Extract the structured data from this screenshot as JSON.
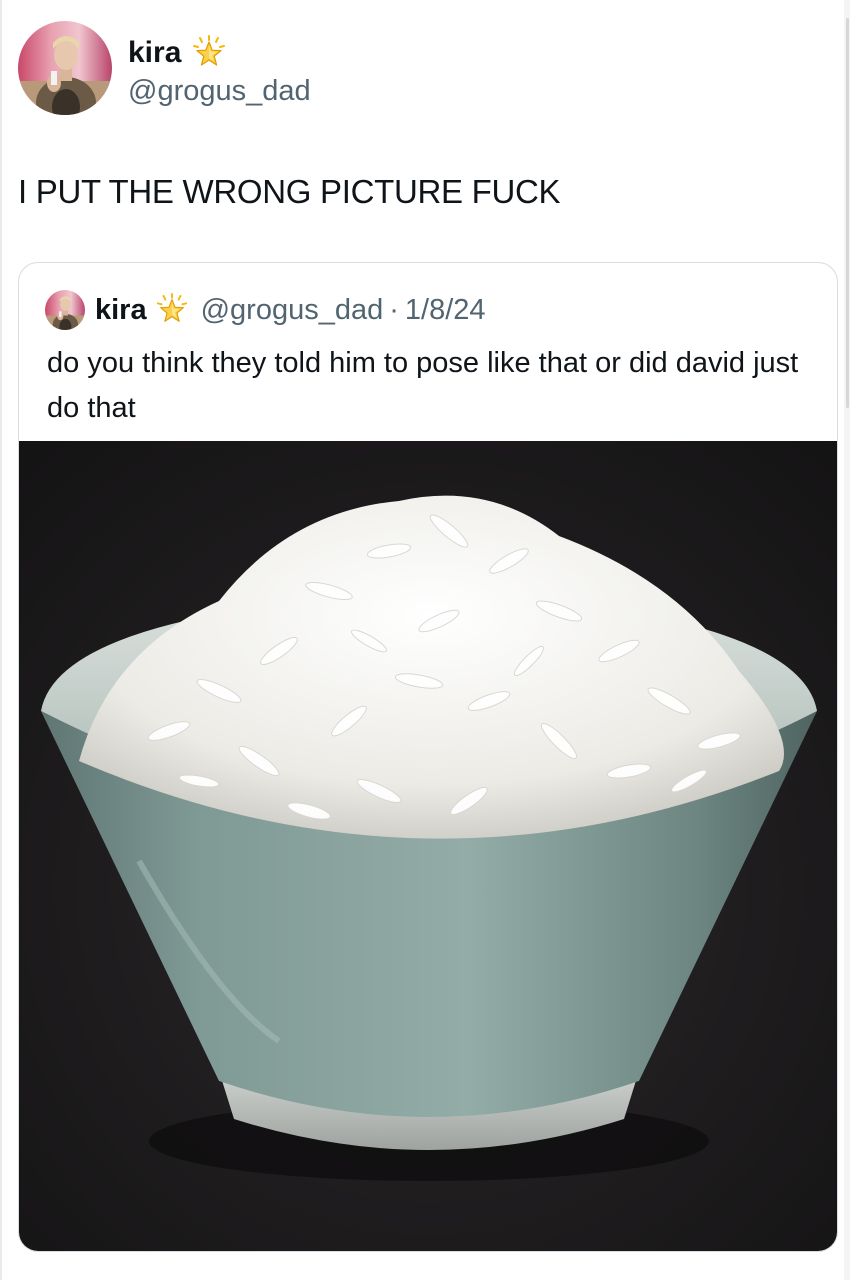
{
  "tweet": {
    "author": {
      "display_name": "kira",
      "handle": "@grogus_dad",
      "avatar_icon": "profile-photo",
      "badge_icon": "sparkle-star-badge-icon"
    },
    "text": "I PUT THE WRONG PICTURE FUCK"
  },
  "quoted_tweet": {
    "author": {
      "display_name": "kira",
      "handle": "@grogus_dad",
      "avatar_icon": "profile-photo",
      "badge_icon": "sparkle-star-badge-icon"
    },
    "separator": "·",
    "date": "1/8/24",
    "text": "do you think they told him to pose like that or did david just do that",
    "media": {
      "type": "photo",
      "subject": "bowl-of-rice"
    }
  },
  "colors": {
    "text_primary": "#0f1419",
    "text_secondary": "#536471",
    "card_border": "#d8dde1",
    "badge_gold": "#f5b70a"
  }
}
